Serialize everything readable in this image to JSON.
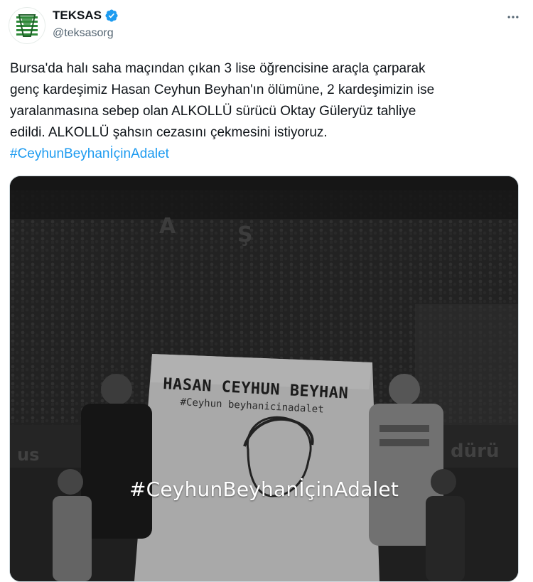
{
  "author": {
    "display_name": "TEKSAS",
    "handle": "@teksasorg",
    "verified": true
  },
  "tweet": {
    "text": "Bursa'da halı saha maçından çıkan 3 lise öğrencisine araçla çarparak\ngenç kardeşimiz Hasan Ceyhun Beyhan'ın ölümüne, 2 kardeşimizin ise\nyaralanmasına sebep olan ALKOLLÜ sürücü Oktay Güleryüz tahliye\nedildi. ALKOLLÜ şahsın cezasını çekmesini istiyoruz.",
    "hashtag": "#CeyhunBeyhanİçinAdalet"
  },
  "media": {
    "overlay_text": "#CeyhunBeyhanİçinAdalet",
    "banner_title": "HASAN CEYHUN BEYHAN",
    "banner_subtitle": "#Ceyhun beyhanicinadalet"
  },
  "icons": {
    "verified": "verified-badge-icon",
    "more": "more-horizontal-icon"
  },
  "colors": {
    "link": "#1d9bf0",
    "text": "#0f1419",
    "secondary": "#536471",
    "verified": "#1d9bf0",
    "brand_green": "#2f8a3a"
  }
}
